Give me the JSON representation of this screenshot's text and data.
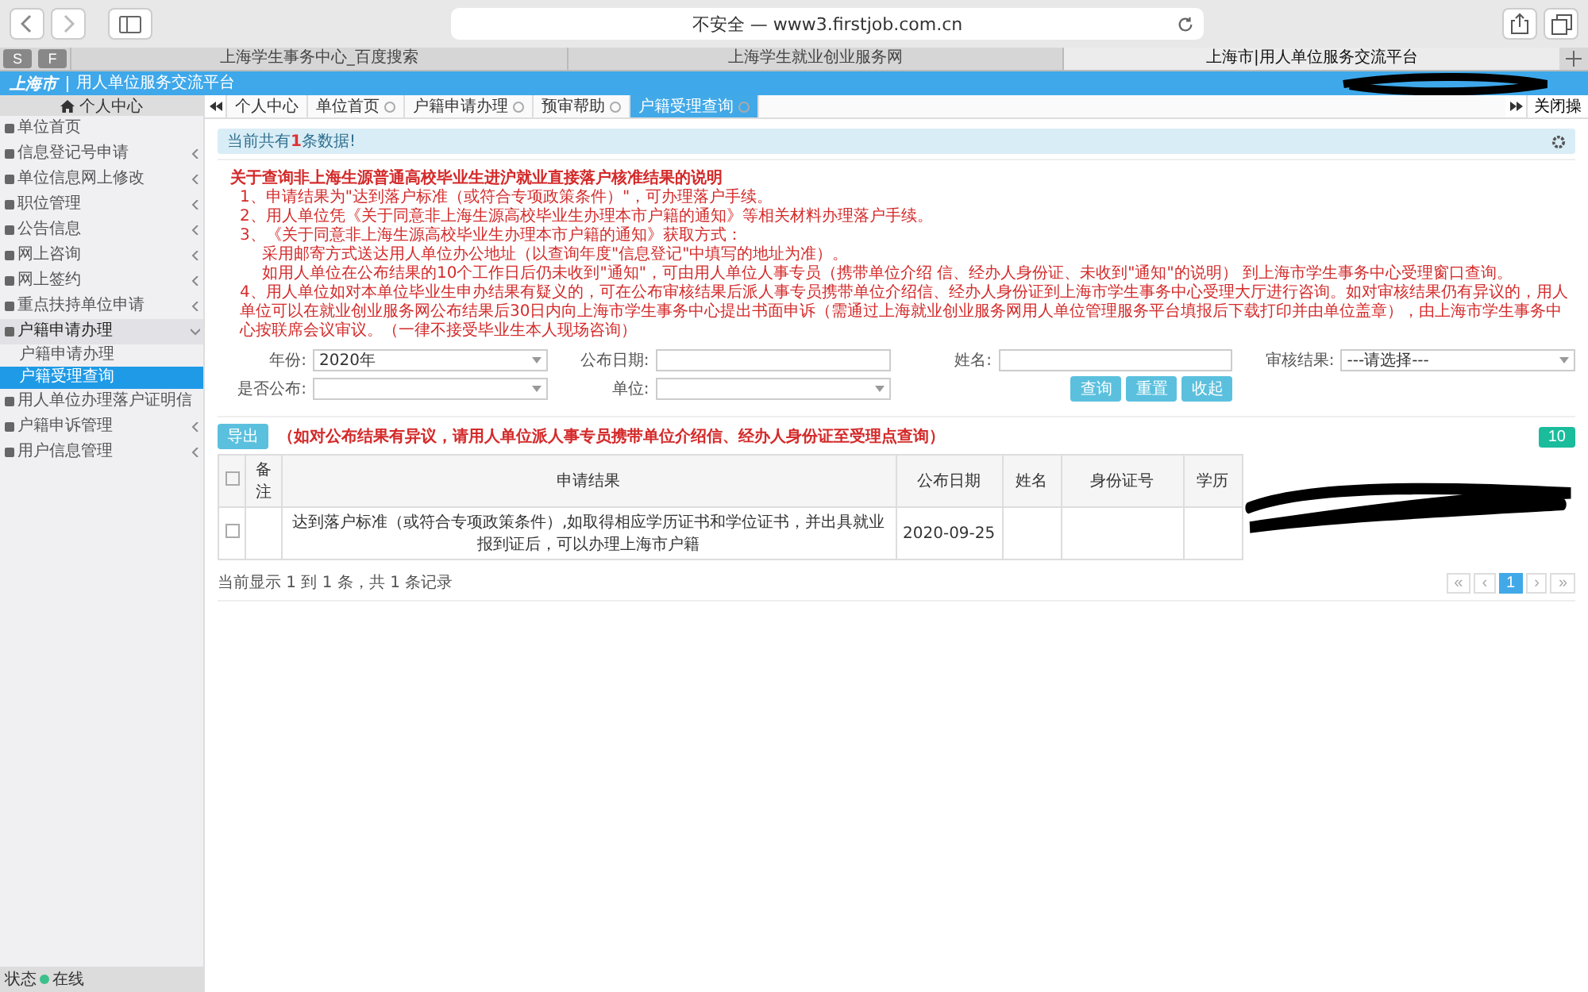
{
  "browser": {
    "address": "不安全 — www3.firstjob.com.cn",
    "favorites": [
      "S",
      "F"
    ],
    "tabs": [
      {
        "label": "上海学生事务中心_百度搜索",
        "selected": false
      },
      {
        "label": "上海学生就业创业服务网",
        "selected": false
      },
      {
        "label": "上海市|用人单位服务交流平台",
        "selected": true
      }
    ]
  },
  "header": {
    "logo": "上海市",
    "title": "用人单位服务交流平台"
  },
  "sidebar": {
    "title": "个人中心",
    "items": [
      {
        "label": "单位首页",
        "kind": "link",
        "expanded": false
      },
      {
        "label": "信息登记号申请",
        "kind": "group",
        "expanded": false
      },
      {
        "label": "单位信息网上修改",
        "kind": "group",
        "expanded": false
      },
      {
        "label": "职位管理",
        "kind": "group",
        "expanded": false
      },
      {
        "label": "公告信息",
        "kind": "group",
        "expanded": false
      },
      {
        "label": "网上咨询",
        "kind": "group",
        "expanded": false
      },
      {
        "label": "网上签约",
        "kind": "group",
        "expanded": false
      },
      {
        "label": "重点扶持单位申请",
        "kind": "group",
        "expanded": false
      },
      {
        "label": "户籍申请办理",
        "kind": "group",
        "expanded": true,
        "children": [
          {
            "label": "户籍申请办理",
            "selected": false
          },
          {
            "label": "户籍受理查询",
            "selected": true
          }
        ]
      },
      {
        "label": "用人单位办理落户证明信",
        "kind": "link",
        "expanded": false
      },
      {
        "label": "户籍申诉管理",
        "kind": "group",
        "expanded": false
      },
      {
        "label": "用户信息管理",
        "kind": "group",
        "expanded": false
      }
    ],
    "status_label": "状态",
    "status": "在线"
  },
  "page_tabs": [
    {
      "label": "个人中心",
      "selected": false,
      "closable": false
    },
    {
      "label": "单位首页",
      "selected": false,
      "closable": true
    },
    {
      "label": "户籍申请办理",
      "selected": false,
      "closable": true
    },
    {
      "label": "预审帮助",
      "selected": false,
      "closable": true
    },
    {
      "label": "户籍受理查询",
      "selected": true,
      "closable": true
    }
  ],
  "close_action": "关闭操",
  "alert": {
    "before": "当前共有",
    "count": "1",
    "after": "条数据!"
  },
  "notice": {
    "title": "关于查询非上海生源普通高校毕业生进沪就业直接落户核准结果的说明",
    "lines": [
      "1、申请结果为\"达到落户标准（或符合专项政策条件）\"，可办理落户手续。",
      "2、用人单位凭《关于同意非上海生源高校毕业生办理本市户籍的通知》等相关材料办理落户手续。",
      "3、《关于同意非上海生源高校毕业生办理本市户籍的通知》获取方式：",
      "采用邮寄方式送达用人单位办公地址（以查询年度\"信息登记\"中填写的地址为准）。",
      "如用人单位在公布结果的10个工作日后仍未收到\"通知\"，可由用人单位人事专员（携带单位介绍 信、经办人身份证、未收到\"通知\"的说明） 到上海市学生事务中心受理窗口查询。",
      "4、用人单位如对本单位毕业生申办结果有疑义的，可在公布审核结果后派人事专员携带单位介绍信、经办人身份证到上海市学生事务中心受理大厅进行咨询。如对审核结果仍有异议的，用人单位可以在就业创业服务网公布结果后30日内向上海市学生事务中心提出书面申诉（需通过上海就业创业服务网用人单位管理服务平台填报后下载打印并由单位盖章），由上海市学生事务中心按联席会议审议。（一律不接受毕业生本人现场咨询）"
    ]
  },
  "filters": [
    {
      "label": "年份:",
      "kind": "select",
      "value": "2020年"
    },
    {
      "label": "公布日期:",
      "kind": "input"
    },
    {
      "label": "姓名:",
      "kind": "input"
    },
    {
      "label": "审核结果:",
      "kind": "select",
      "value": "---请选择---"
    },
    {
      "label": "是否公布:",
      "kind": "select"
    },
    {
      "label": "单位:",
      "kind": "select"
    }
  ],
  "filter_buttons": [
    "查询",
    "重置",
    "收起"
  ],
  "export_button": "导出",
  "table_note": "（如对公布结果有异议，请用人单位派人事专员携带单位介绍信、经办人身份证至受理点查询）",
  "page_size": "10",
  "table": {
    "all_checked": false,
    "columns": [
      "备注",
      "申请结果",
      "公布日期",
      "姓名",
      "身份证号",
      "学历"
    ],
    "rows": [
      {
        "checked": false,
        "cells": [
          "",
          "达到落户标准（或符合专项政策条件）,如取得相应学历证书和学位证书，并出具就业报到证后，可以办理上海市户籍",
          "2020-09-25"
        ]
      }
    ]
  },
  "footer": {
    "summary": "当前显示 1 到 1 条，共 1 条记录",
    "pages": [
      {
        "label": "«",
        "selected": false
      },
      {
        "label": "‹",
        "selected": false
      },
      {
        "label": "1",
        "selected": true
      },
      {
        "label": "›",
        "selected": false
      },
      {
        "label": "»",
        "selected": false
      }
    ]
  }
}
